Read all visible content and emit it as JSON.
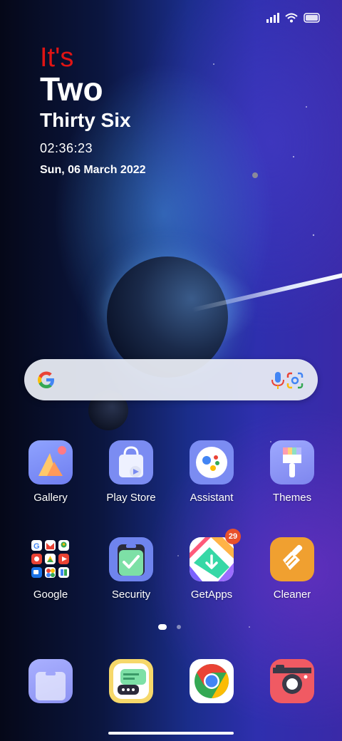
{
  "clock": {
    "line1": "It's",
    "line2": "Two",
    "line3": "Thirty Six",
    "time": "02:36:23",
    "date": "Sun, 06 March 2022",
    "accent_color": "#e01414"
  },
  "status_bar": {
    "icons": [
      "signal-icon",
      "wifi-icon",
      "battery-icon"
    ]
  },
  "search": {
    "icons": [
      "google-g-icon",
      "microphone-icon",
      "google-lens-icon"
    ]
  },
  "apps": [
    {
      "label": "Gallery",
      "icon": "gallery-icon"
    },
    {
      "label": "Play Store",
      "icon": "play-store-icon"
    },
    {
      "label": "Assistant",
      "icon": "assistant-icon"
    },
    {
      "label": "Themes",
      "icon": "themes-icon"
    },
    {
      "label": "Google",
      "icon": "google-folder-icon"
    },
    {
      "label": "Security",
      "icon": "security-icon"
    },
    {
      "label": "GetApps",
      "icon": "getapps-icon",
      "badge": "29"
    },
    {
      "label": "Cleaner",
      "icon": "cleaner-icon"
    }
  ],
  "dock": [
    {
      "icon": "phone-dialer-icon"
    },
    {
      "icon": "messages-icon"
    },
    {
      "icon": "chrome-icon"
    },
    {
      "icon": "camera-icon"
    }
  ],
  "page_indicator": {
    "current": 1,
    "total": 2
  }
}
